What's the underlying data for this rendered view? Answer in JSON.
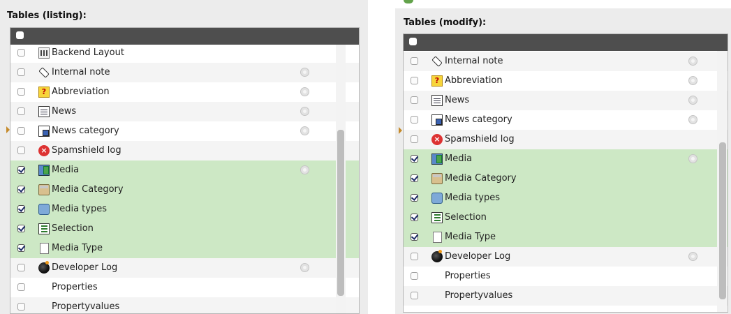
{
  "left": {
    "title": "Tables (listing):",
    "rows": [
      {
        "label": "Backend Layout",
        "icon": "backend-layout-icon",
        "checked": false,
        "info": false,
        "style": ""
      },
      {
        "label": "Internal note",
        "icon": "internal-note-icon",
        "checked": false,
        "info": true,
        "style": "alt"
      },
      {
        "label": "Abbreviation",
        "icon": "abbreviation-icon",
        "checked": false,
        "info": true,
        "style": ""
      },
      {
        "label": "News",
        "icon": "news-icon",
        "checked": false,
        "info": true,
        "style": "alt"
      },
      {
        "label": "News category",
        "icon": "news-category-icon",
        "checked": false,
        "info": true,
        "style": ""
      },
      {
        "label": "Spamshield log",
        "icon": "spamshield-log-icon",
        "checked": false,
        "info": false,
        "style": "alt"
      },
      {
        "label": "Media",
        "icon": "media-icon",
        "checked": true,
        "info": true,
        "style": "sel"
      },
      {
        "label": "Media Category",
        "icon": "media-category-icon",
        "checked": true,
        "info": false,
        "style": "sel"
      },
      {
        "label": "Media types",
        "icon": "media-types-icon",
        "checked": true,
        "info": false,
        "style": "sel"
      },
      {
        "label": "Selection",
        "icon": "selection-icon",
        "checked": true,
        "info": false,
        "style": "sel"
      },
      {
        "label": "Media Type",
        "icon": "media-type-icon",
        "checked": true,
        "info": false,
        "style": "sel"
      },
      {
        "label": "Developer Log",
        "icon": "developer-log-icon",
        "checked": false,
        "info": true,
        "style": "alt"
      },
      {
        "label": "Properties",
        "icon": "",
        "checked": false,
        "info": false,
        "style": ""
      },
      {
        "label": "Propertyvalues",
        "icon": "",
        "checked": false,
        "info": false,
        "style": "alt"
      }
    ]
  },
  "right": {
    "title": "Tables (modify):",
    "rows": [
      {
        "label": "Internal note",
        "icon": "internal-note-icon",
        "checked": false,
        "info": true,
        "style": "alt"
      },
      {
        "label": "Abbreviation",
        "icon": "abbreviation-icon",
        "checked": false,
        "info": true,
        "style": ""
      },
      {
        "label": "News",
        "icon": "news-icon",
        "checked": false,
        "info": true,
        "style": "alt"
      },
      {
        "label": "News category",
        "icon": "news-category-icon",
        "checked": false,
        "info": true,
        "style": ""
      },
      {
        "label": "Spamshield log",
        "icon": "spamshield-log-icon",
        "checked": false,
        "info": false,
        "style": "alt"
      },
      {
        "label": "Media",
        "icon": "media-icon",
        "checked": true,
        "info": true,
        "style": "sel"
      },
      {
        "label": "Media Category",
        "icon": "media-category-icon",
        "checked": true,
        "info": false,
        "style": "sel"
      },
      {
        "label": "Media types",
        "icon": "media-types-icon",
        "checked": true,
        "info": false,
        "style": "sel"
      },
      {
        "label": "Selection",
        "icon": "selection-icon",
        "checked": true,
        "info": false,
        "style": "sel"
      },
      {
        "label": "Media Type",
        "icon": "media-type-icon",
        "checked": true,
        "info": false,
        "style": "sel"
      },
      {
        "label": "Developer Log",
        "icon": "developer-log-icon",
        "checked": false,
        "info": true,
        "style": "alt"
      },
      {
        "label": "Properties",
        "icon": "",
        "checked": false,
        "info": false,
        "style": ""
      },
      {
        "label": "Propertyvalues",
        "icon": "",
        "checked": false,
        "info": false,
        "style": "alt"
      }
    ]
  },
  "colors": {
    "header_bar": "#4e4e4e",
    "selected_row": "#cde8c5",
    "alt_row": "#f4f4f4",
    "panel_bg": "#ececec"
  }
}
